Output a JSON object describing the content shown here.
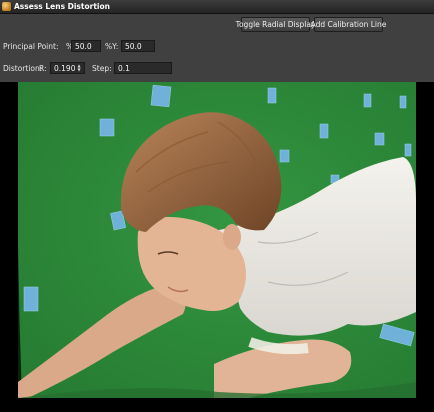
{
  "window": {
    "title": "Assess Lens Distortion"
  },
  "toolbar": {
    "toggle_radial_label": "Toggle Radial Display",
    "add_calibration_label": "Add Calibration Line"
  },
  "principal_point": {
    "label": "Principal Point:",
    "x_label": "%X:",
    "x_value": "50.0",
    "y_label": "%Y:",
    "y_value": "50.0"
  },
  "distortion": {
    "label": "Distortion:",
    "r_label": "R:",
    "r_value": "0.190",
    "step_label": "Step:",
    "step_value": "0.1"
  },
  "colors": {
    "green_screen": "#2f8f3c",
    "highlight_underline": "#d8141a",
    "panel_bg": "#404040"
  },
  "icons": {
    "app_icon": "app-icon",
    "spin_up": "spin-up-icon",
    "spin_down": "spin-down-icon"
  }
}
